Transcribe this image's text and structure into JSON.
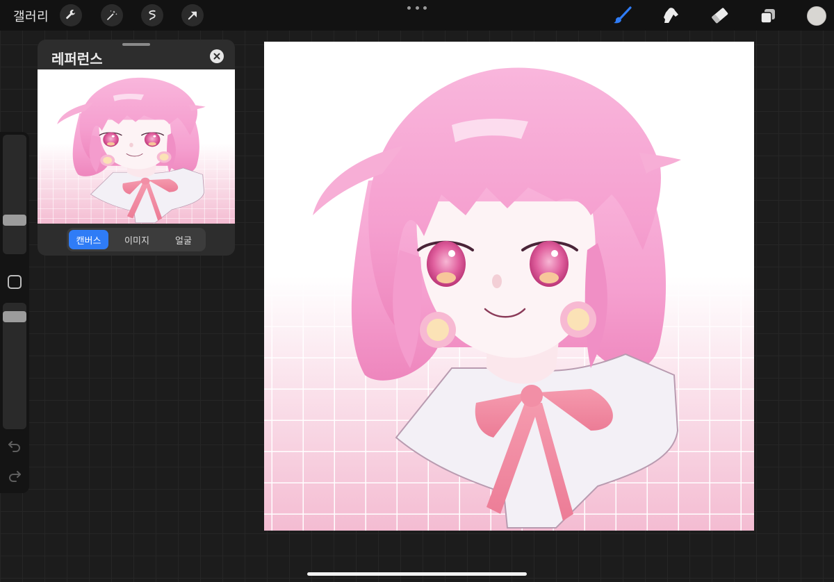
{
  "toolbar": {
    "gallery_label": "갤러리",
    "left_tools": [
      "wrench-icon",
      "magic-wand-icon",
      "selection-icon",
      "transform-arrow-icon"
    ],
    "right_tools": [
      "brush-icon",
      "smudge-icon",
      "eraser-icon",
      "layers-icon"
    ],
    "active_tool": "brush",
    "accent_color": "#2f7cf6",
    "current_color": "#d8d6d2"
  },
  "sidebar": {
    "brush_size_level": 0.32,
    "opacity_level": 0.94,
    "icons": [
      "modify-square-icon",
      "undo-icon",
      "redo-icon"
    ]
  },
  "reference_panel": {
    "title": "레퍼런스",
    "tabs": [
      {
        "label": "캔버스",
        "active": true
      },
      {
        "label": "이미지",
        "active": false
      },
      {
        "label": "얼굴",
        "active": false
      }
    ]
  },
  "canvas": {
    "background_top": "#ffffff",
    "background_bottom": "#f4bcd2",
    "hair_color": "#f5a8d2",
    "eye_color": "#d9408a",
    "ribbon_color": "#ef879f",
    "grid_line_color": "#ffffff"
  }
}
